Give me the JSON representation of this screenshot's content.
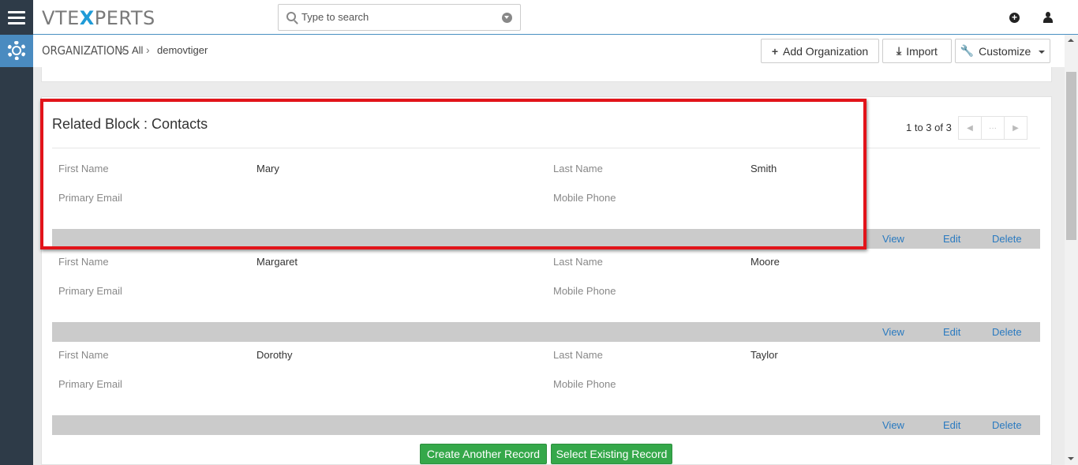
{
  "app": {
    "logo_left": "VTE",
    "logo_x": "X",
    "logo_right": "PERTS"
  },
  "search": {
    "placeholder": "Type to search"
  },
  "breadcrumb": {
    "module": "ORGANIZATIONS",
    "filter": "All",
    "record": "demovtiger"
  },
  "header_buttons": {
    "add": "Add Organization",
    "import": "Import",
    "customize": "Customize"
  },
  "block": {
    "title": "Related Block : Contacts",
    "pager_text": "1 to 3 of 3",
    "labels": {
      "first_name": "First Name",
      "last_name": "Last Name",
      "primary_email": "Primary Email",
      "mobile_phone": "Mobile Phone"
    },
    "records": [
      {
        "first_name": "Mary",
        "last_name": "Smith",
        "primary_email": "",
        "mobile_phone": ""
      },
      {
        "first_name": "Margaret",
        "last_name": "Moore",
        "primary_email": "",
        "mobile_phone": ""
      },
      {
        "first_name": "Dorothy",
        "last_name": "Taylor",
        "primary_email": "",
        "mobile_phone": ""
      }
    ],
    "actions": {
      "view": "View",
      "edit": "Edit",
      "delete": "Delete"
    }
  },
  "footer_buttons": {
    "create": "Create Another Record",
    "select": "Select Existing Record"
  },
  "colors": {
    "rail": "#2e3b48",
    "accent": "#4a8bc0",
    "highlight": "#e2141a",
    "green": "#35a84a",
    "link": "#2a7ac0"
  }
}
